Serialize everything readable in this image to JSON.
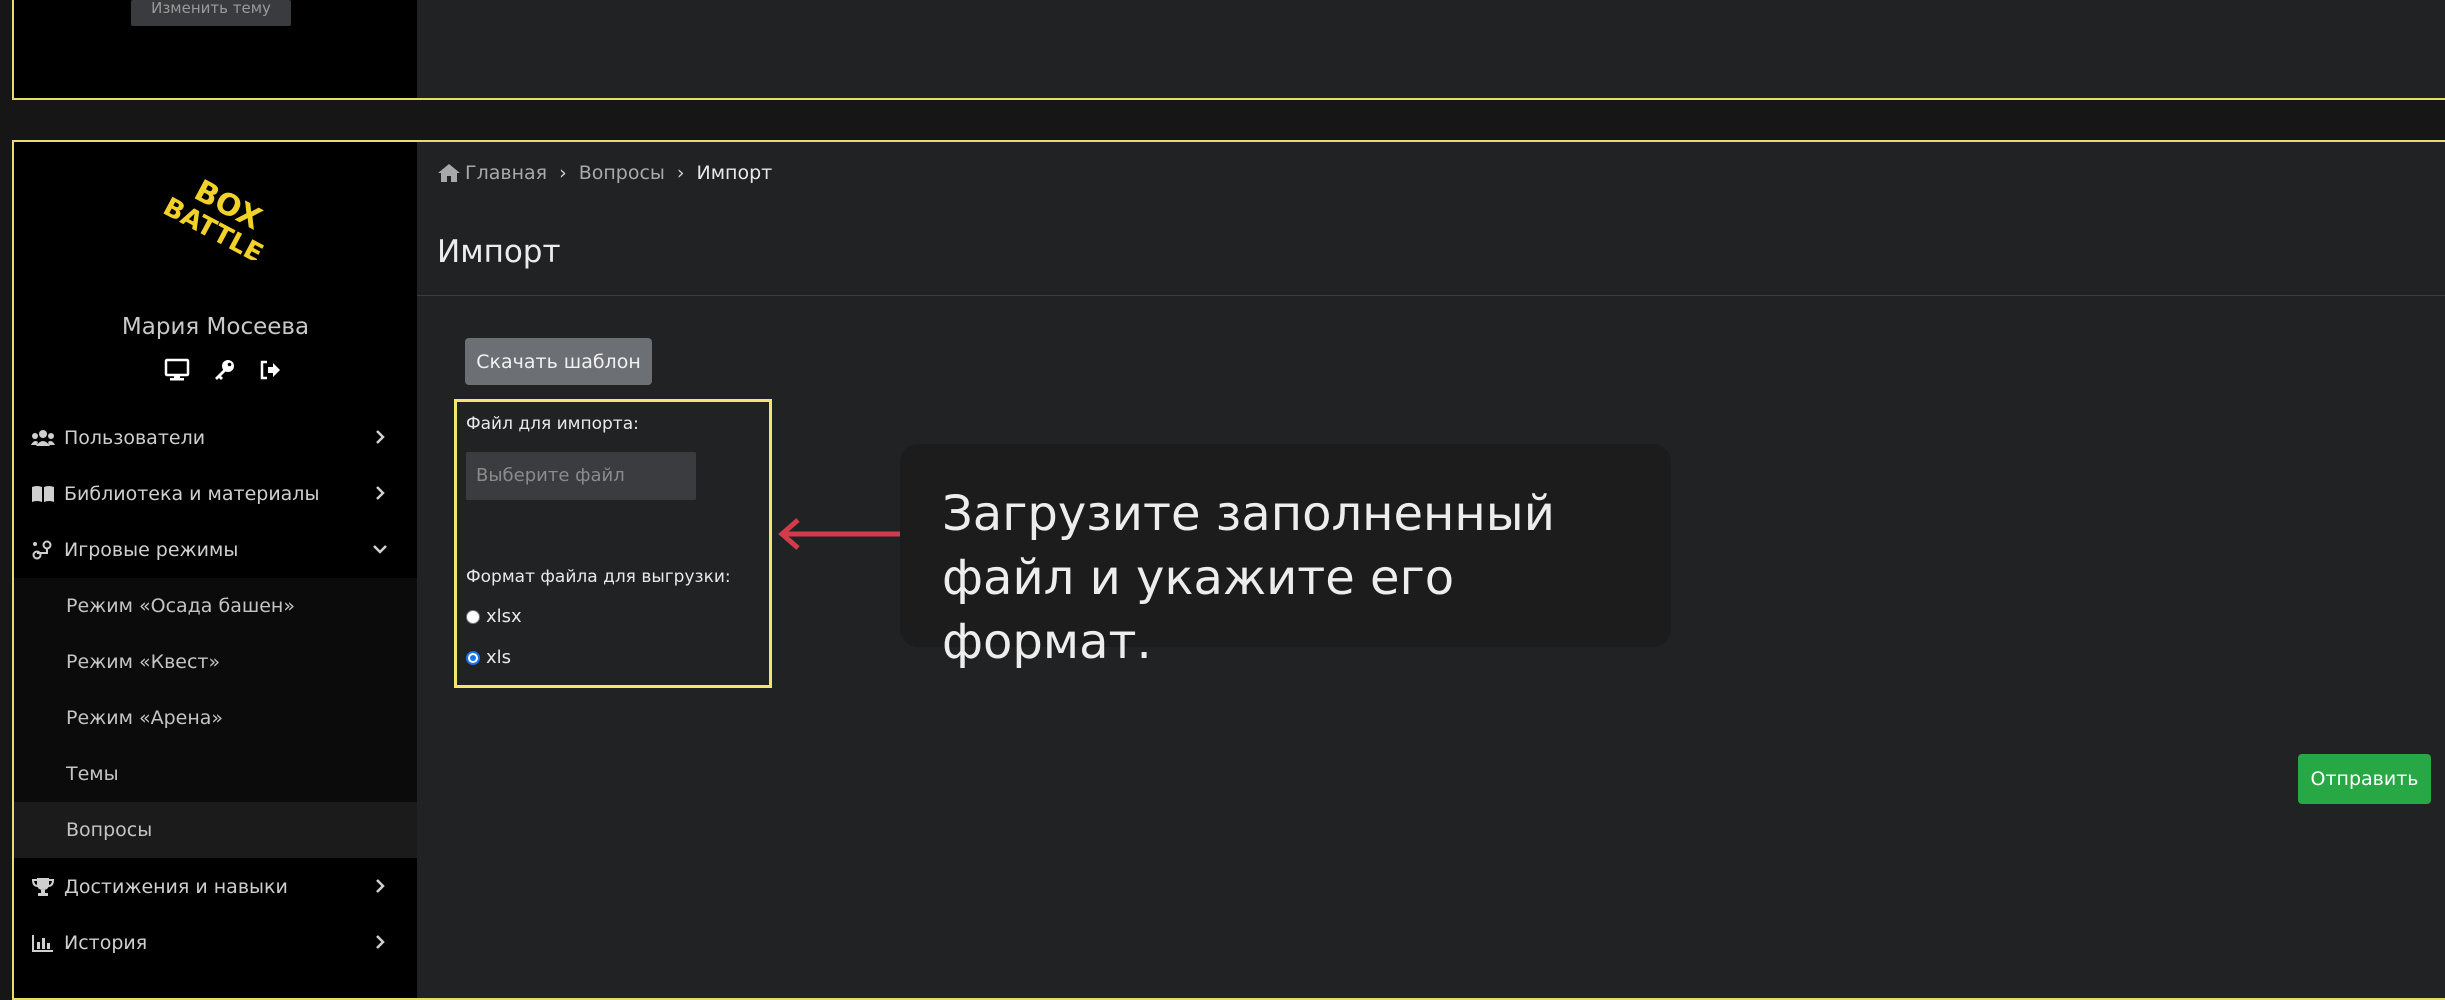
{
  "top_panel": {
    "theme_button_label": "Изменить тему"
  },
  "sidebar": {
    "logo_line1": "BOX",
    "logo_line2": "BATTLE",
    "user_name": "Мария Мосеева",
    "user_icons": [
      "monitor-icon",
      "key-icon",
      "logout-icon"
    ],
    "items": [
      {
        "label": "Пользователи",
        "icon": "users-icon"
      },
      {
        "label": "Библиотека и материалы",
        "icon": "book-icon"
      },
      {
        "label": "Игровые режимы",
        "icon": "game-modes-icon",
        "expanded": true
      },
      {
        "label": "Достижения и навыки",
        "icon": "trophy-icon"
      },
      {
        "label": "История",
        "icon": "chart-icon"
      }
    ],
    "subitems": [
      {
        "label": "Режим «Осада башен»"
      },
      {
        "label": "Режим «Квест»"
      },
      {
        "label": "Режим «Арена»"
      },
      {
        "label": "Темы"
      },
      {
        "label": "Вопросы",
        "active": true
      }
    ]
  },
  "breadcrumb": {
    "home": "Главная",
    "section": "Вопросы",
    "current": "Импорт"
  },
  "page": {
    "title": "Импорт",
    "download_button": "Скачать шаблон",
    "file_label": "Файл для импорта:",
    "file_placeholder": "Выберите файл",
    "format_label": "Формат файла для выгрузки:",
    "formats": [
      {
        "label": "xlsx",
        "checked": false
      },
      {
        "label": "xls",
        "checked": true
      }
    ],
    "submit_button": "Отправить"
  },
  "callout": {
    "line1": "Загрузите заполненный",
    "line2": "файл и укажите его формат."
  },
  "colors": {
    "highlight": "#f4e572",
    "arrow": "#d23b4b",
    "submit": "#28a745",
    "logo": "#f2d22a"
  }
}
